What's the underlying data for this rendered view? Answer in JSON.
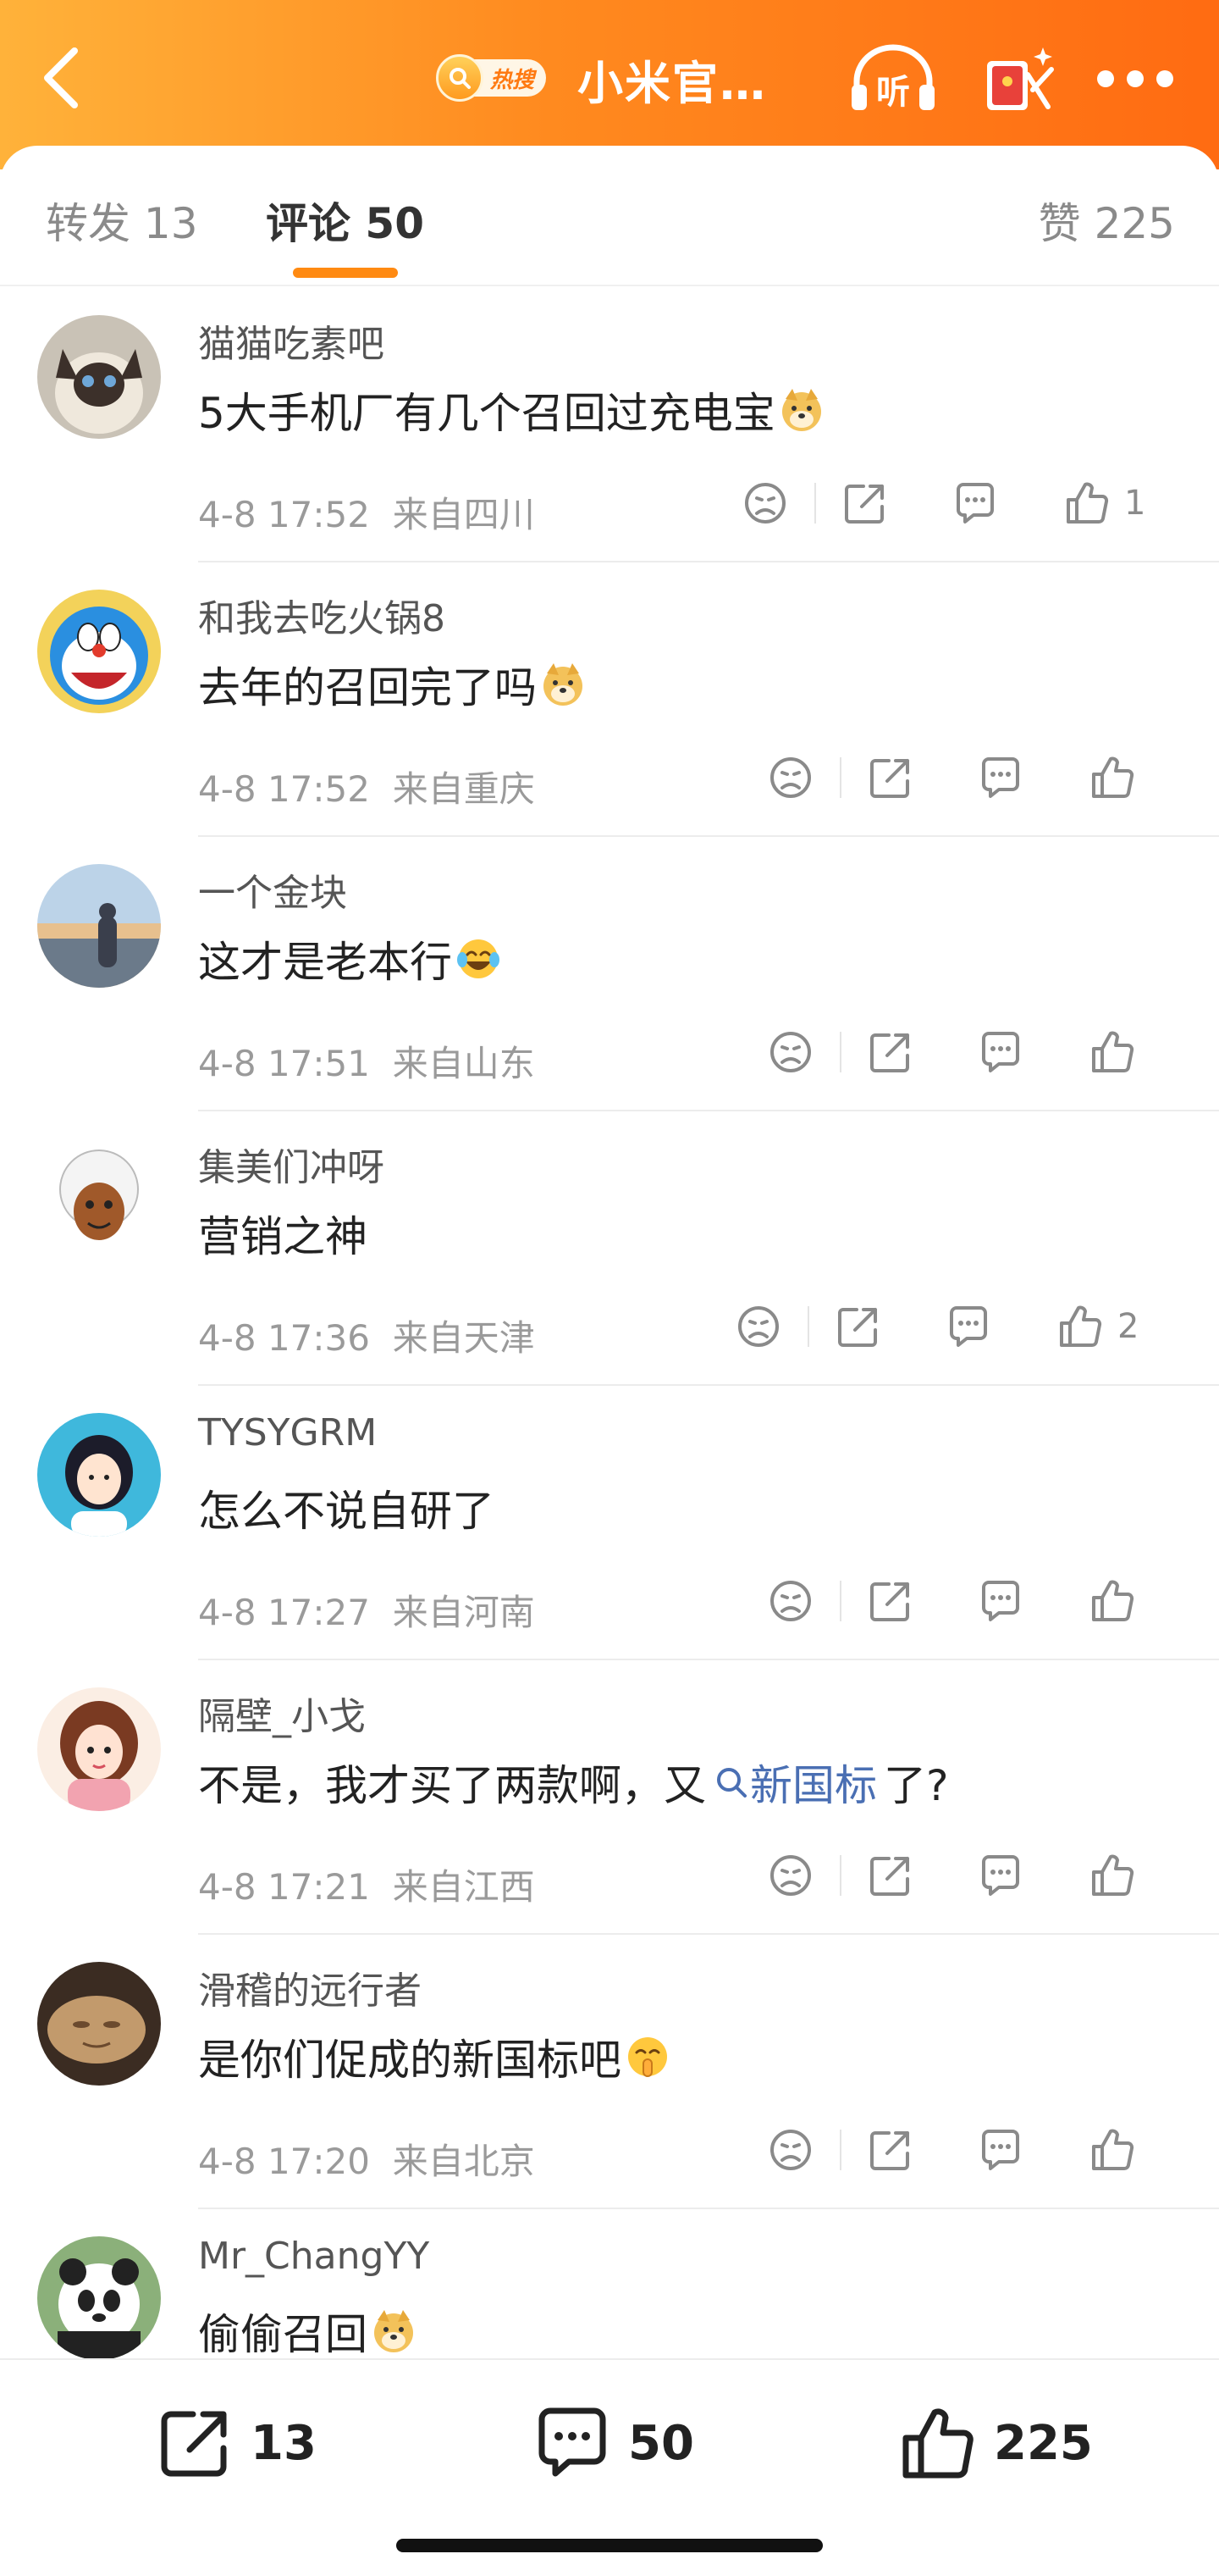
{
  "header": {
    "back_icon": "chevron-left-icon",
    "hot_badge_label": "热搜",
    "title": "小米官…",
    "listen_label": "听",
    "gradient_colors": [
      "#ffb23a",
      "#ff6b12"
    ]
  },
  "tabs": {
    "repost_label": "转发",
    "repost_count": "13",
    "comment_label": "评论",
    "comment_count": "50",
    "like_label": "赞",
    "like_count": "225",
    "accent_color": "#ff8a12"
  },
  "comments": [
    {
      "username": "猫猫吃素吧",
      "text": "5大手机厂有几个召回过充电宝",
      "emoji": "doge",
      "time": "4-8 17:52",
      "location": "来自四川",
      "likes": "1"
    },
    {
      "username": "和我去吃火锅8",
      "text": "去年的召回完了吗",
      "emoji": "doge",
      "time": "4-8 17:52",
      "location": "来自重庆",
      "likes": ""
    },
    {
      "username": "一个金块",
      "text": "这才是老本行 ",
      "emoji": "laugh-cry",
      "time": "4-8 17:51",
      "location": "来自山东",
      "likes": ""
    },
    {
      "username": "集美们冲呀",
      "text": "营销之神",
      "emoji": "",
      "time": "4-8 17:36",
      "location": "来自天津",
      "likes": "2"
    },
    {
      "username": "TYSYGRM",
      "text": "怎么不说自研了",
      "emoji": "",
      "time": "4-8 17:27",
      "location": "来自河南",
      "likes": ""
    },
    {
      "username": "隔壁_小戈",
      "text_before": "不是，我才买了两款啊，又",
      "topic": "新国标",
      "text_after": " 了?",
      "time": "4-8 17:21",
      "location": "来自江西",
      "likes": ""
    },
    {
      "username": "滑稽的远行者",
      "text": "是你们促成的新国标吧",
      "emoji": "shush",
      "time": "4-8 17:20",
      "location": "来自北京",
      "likes": ""
    },
    {
      "username": "Mr_ChangYY",
      "text": "偷偷召回",
      "emoji": "doge",
      "time": "",
      "location": "",
      "likes": ""
    }
  ],
  "bottom_bar": {
    "repost_count": "13",
    "comment_count": "50",
    "like_count": "225"
  }
}
